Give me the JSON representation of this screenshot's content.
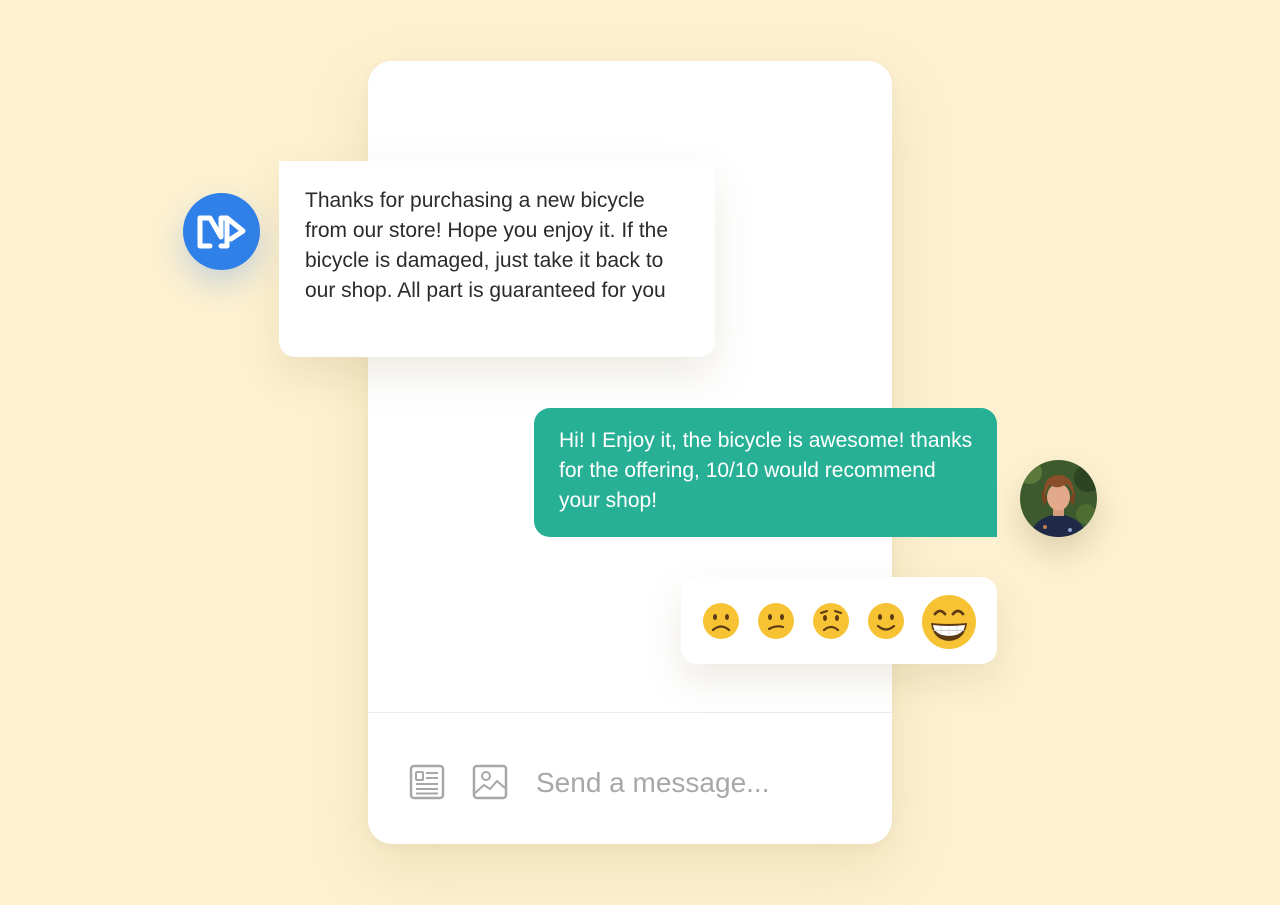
{
  "conversation": {
    "incoming_message": "Thanks for purchasing a new bicycle from our store! Hope you enjoy it. If the bicycle is damaged, just take it back to our shop. All part is guaranteed for you",
    "outgoing_message": "Hi! I Enjoy it, the bicycle is awesome! thanks for the offering, 10/10 would recommend your shop!"
  },
  "rating": {
    "options": [
      "frowning",
      "confused",
      "worried",
      "slightly-smiling",
      "grinning"
    ],
    "selected": "grinning"
  },
  "composer": {
    "placeholder": "Send a message...",
    "value": ""
  },
  "colors": {
    "background": "#fdf1d1",
    "brand_avatar": "#2f80e8",
    "outgoing_bubble": "#27b095",
    "emoji_face": "#f7c234"
  }
}
